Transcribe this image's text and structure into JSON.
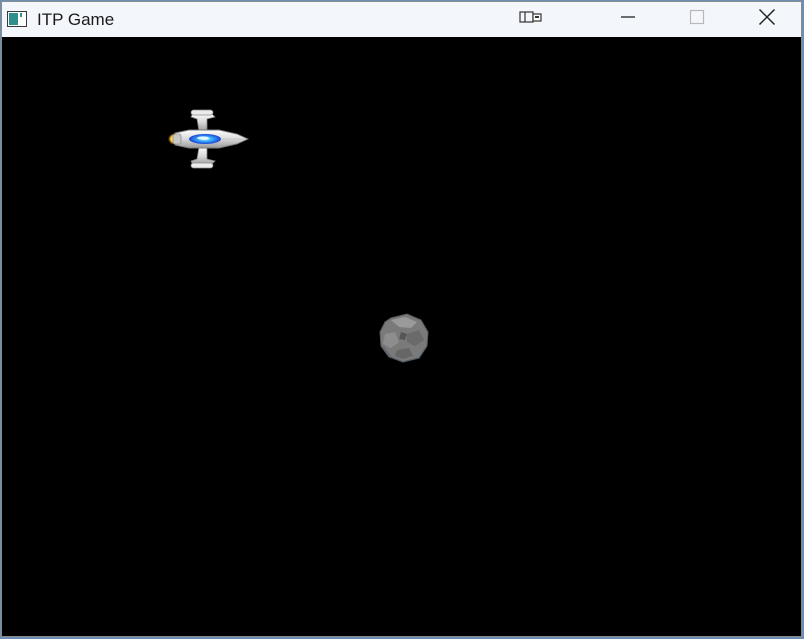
{
  "window": {
    "title": "ITP Game",
    "controls": {
      "extra_icon": "snap-layout-icon",
      "minimize_icon": "minimize-icon",
      "maximize_icon": "maximize-icon",
      "close_icon": "close-icon"
    }
  },
  "game": {
    "background_color": "#000000",
    "sprites": {
      "player": "spaceship-icon",
      "obstacle": "asteroid-icon"
    }
  }
}
